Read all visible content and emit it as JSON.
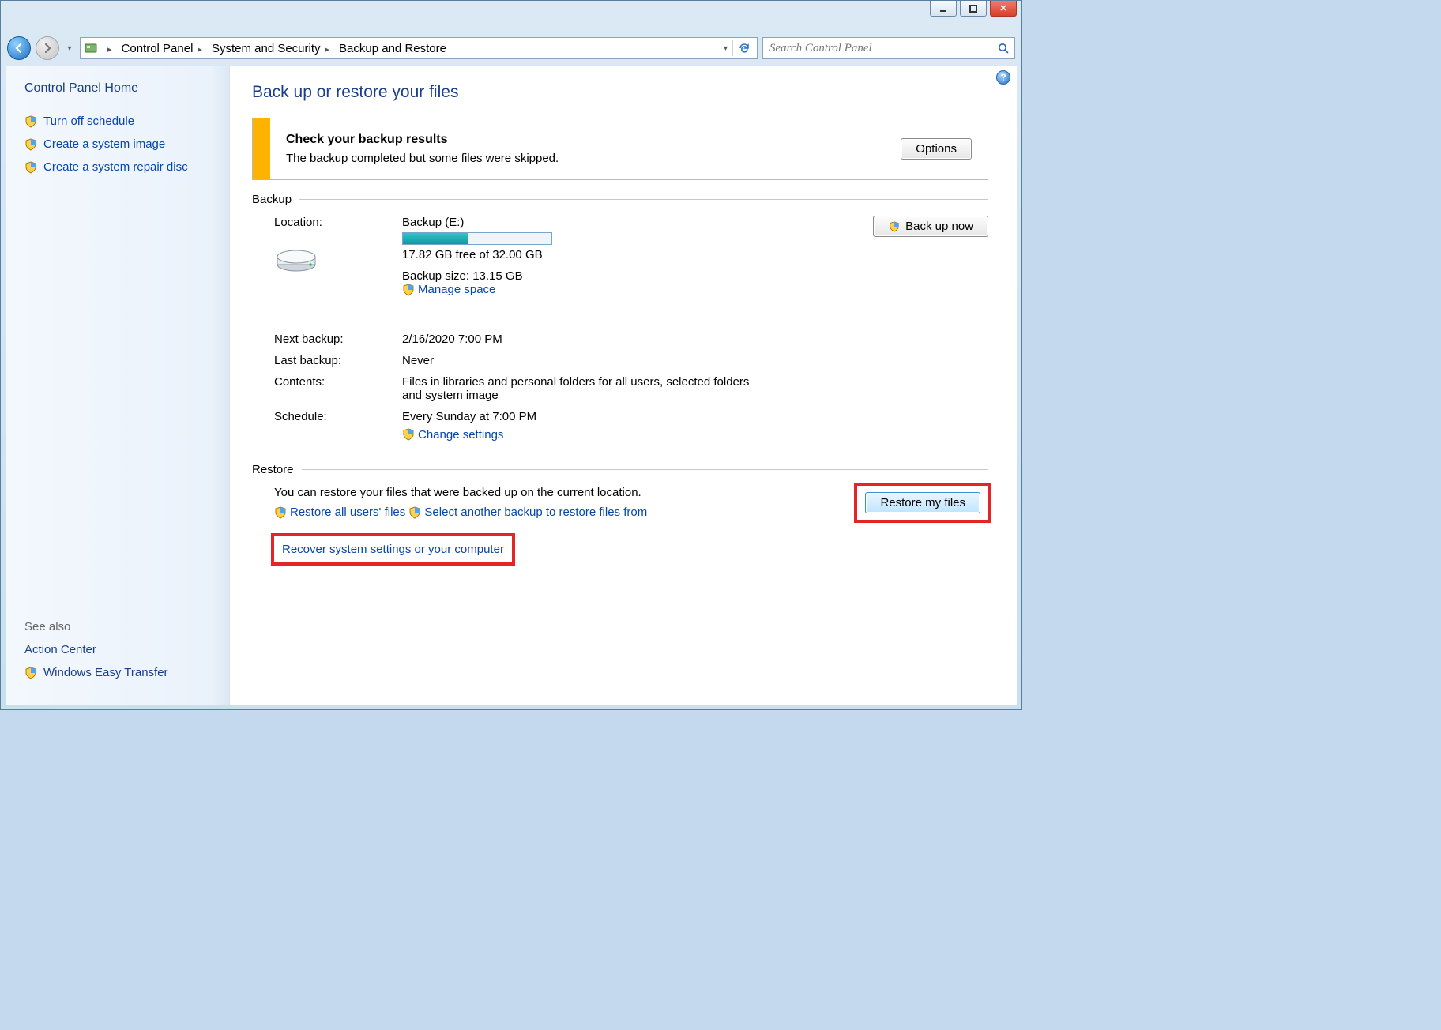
{
  "caption": {
    "minimize": "—",
    "maximize": "▢"
  },
  "breadcrumb": {
    "root": "Control Panel",
    "level2": "System and Security",
    "level3": "Backup and Restore"
  },
  "search": {
    "placeholder": "Search Control Panel"
  },
  "sidebar": {
    "home": "Control Panel Home",
    "links": {
      "turn_off_schedule": "Turn off schedule",
      "create_system_image": "Create a system image",
      "create_repair_disc": "Create a system repair disc"
    },
    "see_also_label": "See also",
    "see_also": {
      "action_center": "Action Center",
      "easy_transfer": "Windows Easy Transfer"
    }
  },
  "page": {
    "title": "Back up or restore your files"
  },
  "warn": {
    "title": "Check your backup results",
    "body": "The backup completed but some files were skipped.",
    "options_btn": "Options"
  },
  "backup": {
    "heading": "Backup",
    "location_label": "Location:",
    "location_name": "Backup (E:)",
    "free_text": "17.82 GB free of 32.00 GB",
    "size_text": "Backup size: 13.15 GB",
    "manage_space": "Manage space",
    "back_up_now": "Back up now",
    "next_label": "Next backup:",
    "next_val": "2/16/2020 7:00 PM",
    "last_label": "Last backup:",
    "last_val": "Never",
    "contents_label": "Contents:",
    "contents_val": "Files in libraries and personal folders for all users, selected folders and system image",
    "schedule_label": "Schedule:",
    "schedule_val": "Every Sunday at 7:00 PM",
    "change_settings": "Change settings"
  },
  "restore": {
    "heading": "Restore",
    "desc": "You can restore your files that were backed up on the current location.",
    "restore_all_users": "Restore all users' files",
    "select_another": "Select another backup to restore files from",
    "restore_my_files": "Restore my files",
    "recover_system": "Recover system settings or your computer"
  }
}
